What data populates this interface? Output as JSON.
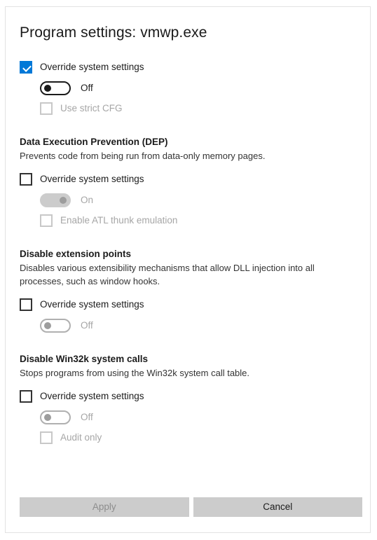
{
  "dialog": {
    "title": "Program settings: vmwp.exe",
    "accent_color": "#0078d7",
    "button_bg_color": "#cccccc"
  },
  "sections": [
    {
      "id": "cfg",
      "heading": "",
      "description": "",
      "override": {
        "label": "Override system settings",
        "checked": true,
        "disabled": false
      },
      "toggle": {
        "label": "Off",
        "state": "off",
        "disabled": false
      },
      "sub_checkbox": {
        "label": "Use strict CFG",
        "checked": false,
        "disabled": true
      }
    },
    {
      "id": "dep",
      "heading": "Data Execution Prevention (DEP)",
      "description": "Prevents code from being run from data-only memory pages.",
      "override": {
        "label": "Override system settings",
        "checked": false,
        "disabled": false
      },
      "toggle": {
        "label": "On",
        "state": "on",
        "disabled": true
      },
      "sub_checkbox": {
        "label": "Enable ATL thunk emulation",
        "checked": false,
        "disabled": true
      }
    },
    {
      "id": "extension-points",
      "heading": "Disable extension points",
      "description": "Disables various extensibility mechanisms that allow DLL injection into all processes, such as window hooks.",
      "override": {
        "label": "Override system settings",
        "checked": false,
        "disabled": false
      },
      "toggle": {
        "label": "Off",
        "state": "off",
        "disabled": true
      },
      "sub_checkbox": null
    },
    {
      "id": "win32k",
      "heading": "Disable Win32k system calls",
      "description": "Stops programs from using the Win32k system call table.",
      "override": {
        "label": "Override system settings",
        "checked": false,
        "disabled": false
      },
      "toggle": {
        "label": "Off",
        "state": "off",
        "disabled": true
      },
      "sub_checkbox": {
        "label": "Audit only",
        "checked": false,
        "disabled": true
      }
    }
  ],
  "footer": {
    "apply_label": "Apply",
    "apply_disabled": true,
    "cancel_label": "Cancel",
    "cancel_disabled": false
  }
}
